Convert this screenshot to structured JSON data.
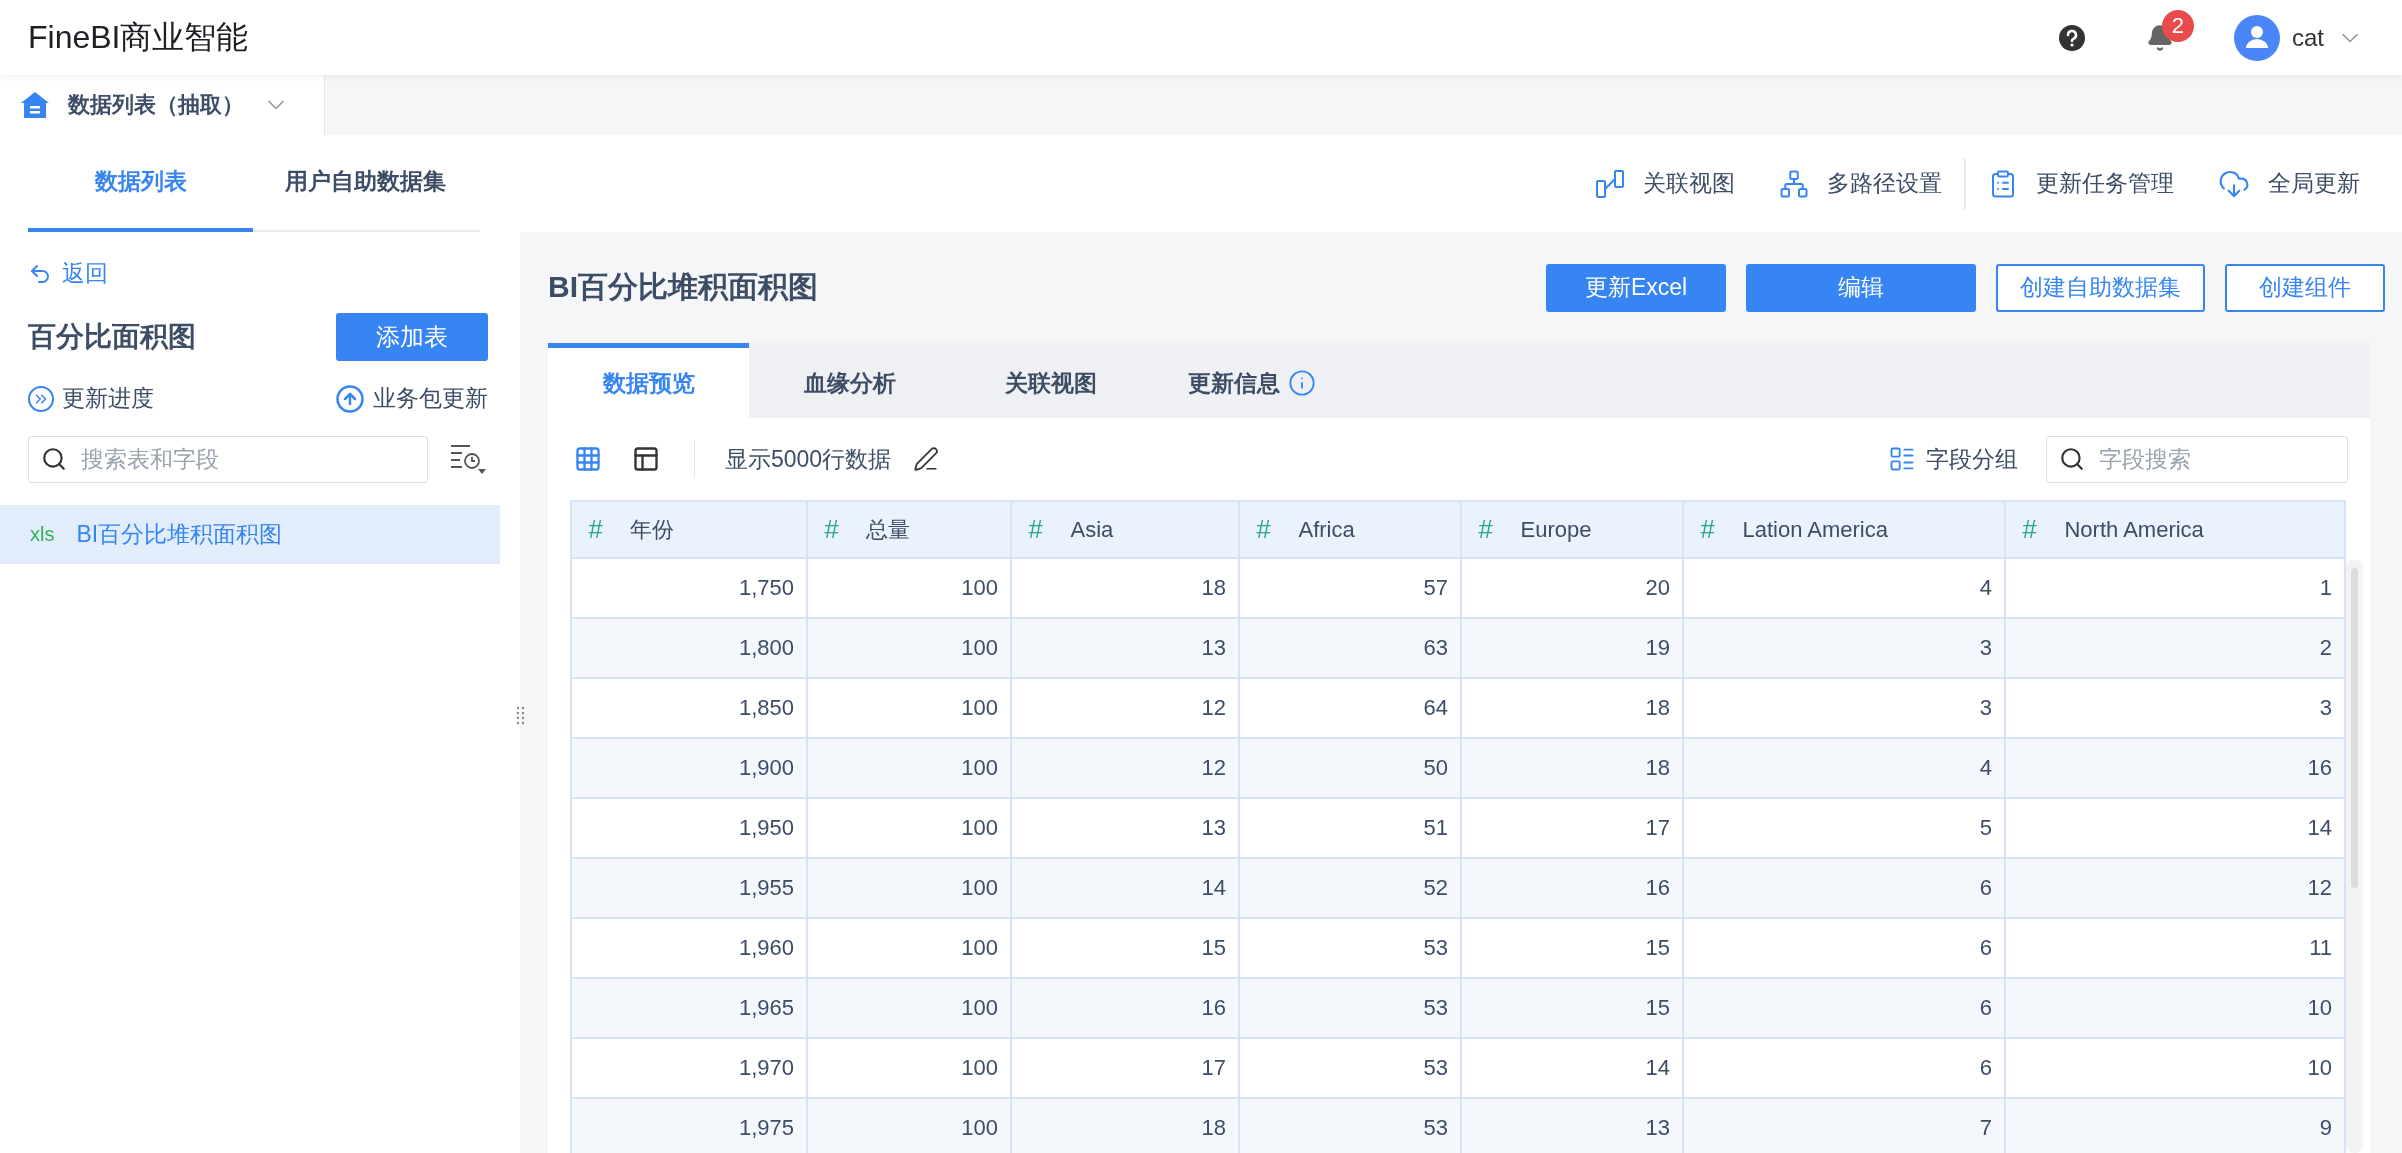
{
  "app_title": "FineBI商业智能",
  "header": {
    "notification_count": "2",
    "user": "cat"
  },
  "package_tab": {
    "label": "数据列表（抽取）"
  },
  "left_tabs": [
    {
      "label": "数据列表",
      "selected": true
    },
    {
      "label": "用户自助数据集",
      "selected": false
    }
  ],
  "back": "返回",
  "package": {
    "title": "百分比面积图",
    "add_button": "添加表"
  },
  "package_actions": [
    {
      "kind": "progress",
      "label": "更新进度"
    },
    {
      "kind": "upload",
      "label": "业务包更新"
    }
  ],
  "table_search": {
    "placeholder": "搜索表和字段"
  },
  "tables": [
    {
      "badge": "xls",
      "name": "BI百分比堆积面积图",
      "selected": true
    }
  ],
  "toolbar_actions": [
    {
      "kind": "relation",
      "label": "关联视图"
    },
    {
      "kind": "paths",
      "label": "多路径设置"
    },
    {
      "kind": "tasks",
      "label": "更新任务管理"
    },
    {
      "kind": "global",
      "label": "全局更新"
    }
  ],
  "main_title": "BI百分比堆积面积图",
  "main_buttons": [
    {
      "label": "更新Excel",
      "kind": "primary"
    },
    {
      "label": "编辑",
      "kind": "primary"
    },
    {
      "label": "创建自助数据集",
      "kind": "outline"
    },
    {
      "label": "创建组件",
      "kind": "outline"
    }
  ],
  "detail_tabs": [
    {
      "label": "数据预览",
      "selected": true,
      "info": false
    },
    {
      "label": "血缘分析",
      "selected": false,
      "info": false
    },
    {
      "label": "关联视图",
      "selected": false,
      "info": false
    },
    {
      "label": "更新信息",
      "selected": false,
      "info": true
    }
  ],
  "views": [
    {
      "kind": "grid",
      "selected": true
    },
    {
      "kind": "panel",
      "selected": false
    }
  ],
  "row_limit": "显示5000行数据",
  "field_group": "字段分组",
  "field_search": {
    "placeholder": "字段搜索"
  },
  "table": {
    "columns": [
      {
        "type_mark": "#",
        "name": "年份"
      },
      {
        "type_mark": "#",
        "name": "总量"
      },
      {
        "type_mark": "#",
        "name": "Asia"
      },
      {
        "type_mark": "#",
        "name": "Africa"
      },
      {
        "type_mark": "#",
        "name": "Europe"
      },
      {
        "type_mark": "#",
        "name": "Lation America"
      },
      {
        "type_mark": "#",
        "name": "North America"
      }
    ],
    "rows": [
      [
        "1,750",
        "100",
        "18",
        "57",
        "20",
        "4",
        "1"
      ],
      [
        "1,800",
        "100",
        "13",
        "63",
        "19",
        "3",
        "2"
      ],
      [
        "1,850",
        "100",
        "12",
        "64",
        "18",
        "3",
        "3"
      ],
      [
        "1,900",
        "100",
        "12",
        "50",
        "18",
        "4",
        "16"
      ],
      [
        "1,950",
        "100",
        "13",
        "51",
        "17",
        "5",
        "14"
      ],
      [
        "1,955",
        "100",
        "14",
        "52",
        "16",
        "6",
        "12"
      ],
      [
        "1,960",
        "100",
        "15",
        "53",
        "15",
        "6",
        "11"
      ],
      [
        "1,965",
        "100",
        "16",
        "53",
        "15",
        "6",
        "10"
      ],
      [
        "1,970",
        "100",
        "17",
        "53",
        "14",
        "6",
        "10"
      ],
      [
        "1,975",
        "100",
        "18",
        "53",
        "13",
        "7",
        "9"
      ]
    ]
  }
}
